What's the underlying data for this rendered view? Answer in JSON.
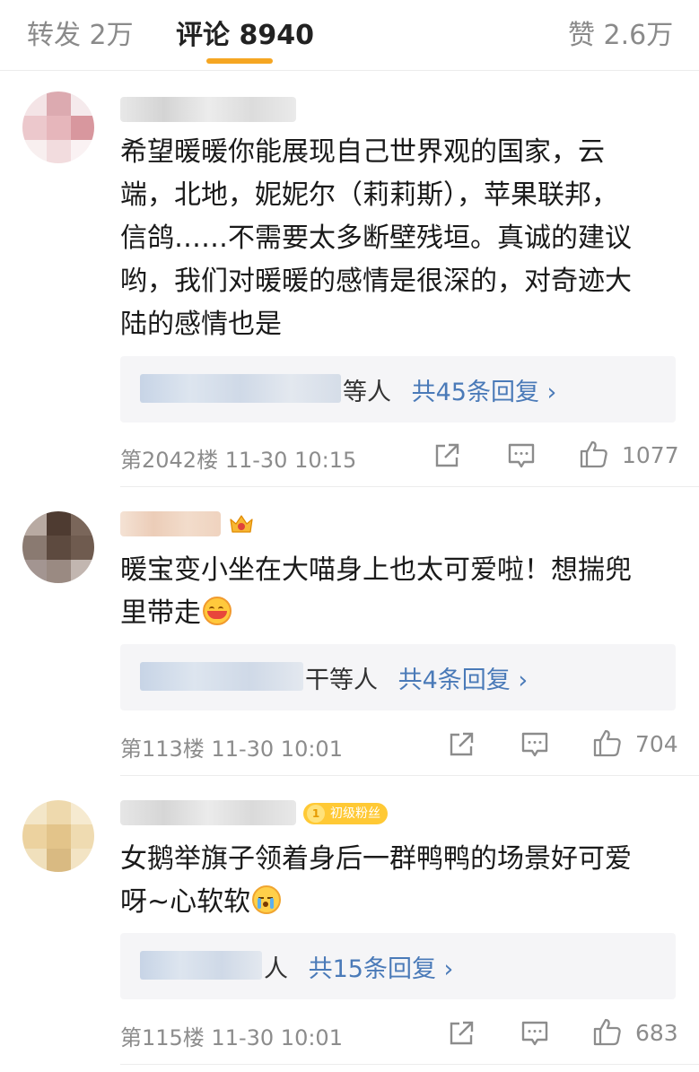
{
  "tabs": {
    "repost": "转发 2万",
    "comments": "评论 8940",
    "likes": "赞 2.6万"
  },
  "comments": [
    {
      "text_lines": [
        "希望暖暖你能展现自己世界观的国家，云",
        "端，北地，妮妮尔（莉莉斯），苹果联邦，",
        "信鸽……不需要太多断壁残垣。真诚的建议",
        "哟，我们对暖暖的感情是很深的，对奇迹大",
        "陆的感情也是"
      ],
      "reply_prefix": "等人",
      "reply_link": "共45条回复 ›",
      "floor_time": "第2042楼 11-30 10:15",
      "likes": "1077"
    },
    {
      "text": "暖宝变小坐在大喵身上也太可爱啦！想揣兜",
      "text_line2": "里带走",
      "reply_prefix": "干等人",
      "reply_link": "共4条回复 ›",
      "floor_time": "第113楼 11-30 10:01",
      "likes": "704"
    },
    {
      "badge_number": "1",
      "badge_label": "初级粉丝",
      "text": "女鹅举旗子领着身后一群鸭鸭的场景好可爱",
      "text_line2": "呀~心软软",
      "reply_prefix": "人",
      "reply_link": "共15条回复 ›",
      "floor_time": "第115楼 11-30 10:01",
      "likes": "683"
    }
  ],
  "icons": [
    "share-icon",
    "comment-icon",
    "like-icon",
    "crown-icon"
  ],
  "colors": {
    "accent": "#f5a623",
    "link": "#4a7ab8",
    "reply_bg": "#f5f5f7",
    "meta": "#8c8c8c"
  }
}
